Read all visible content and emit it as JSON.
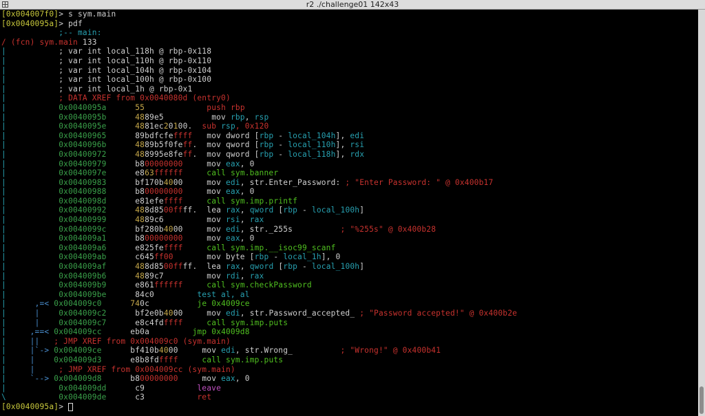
{
  "window": {
    "title": "r2 ./challenge01 142x43"
  },
  "colors": {
    "prompt": "#c9c93c",
    "white": "#d0d0d0",
    "bright": "#ffffff",
    "addr": "#3aa14a",
    "red": "#c8322e",
    "green": "#50c020",
    "cyan": "#27a0b0",
    "yellow": "#c6a84a",
    "blue": "#4a8fd0",
    "magenta": "#c050c0"
  },
  "terminal": {
    "lines": [
      [
        [
          "prompt",
          "[0x004007f0]"
        ],
        [
          "white",
          "> s sym.main"
        ]
      ],
      [
        [
          "prompt",
          "[0x0040095a]"
        ],
        [
          "white",
          "> pdf"
        ]
      ],
      [
        [
          "cyan",
          "            ;-- main:"
        ]
      ],
      [
        [
          "red",
          "/ (fcn) sym.main"
        ],
        [
          "white",
          " 133"
        ]
      ],
      [
        [
          "cyan",
          "|"
        ],
        [
          "white",
          "           ; var int local_118h @ rbp-0x118"
        ]
      ],
      [
        [
          "cyan",
          "|"
        ],
        [
          "white",
          "           ; var int local_110h @ rbp-0x110"
        ]
      ],
      [
        [
          "cyan",
          "|"
        ],
        [
          "white",
          "           ; var int local_104h @ rbp-0x104"
        ]
      ],
      [
        [
          "cyan",
          "|"
        ],
        [
          "white",
          "           ; var int local_100h @ rbp-0x100"
        ]
      ],
      [
        [
          "cyan",
          "|"
        ],
        [
          "white",
          "           ; var int local_1h @ rbp-0x1"
        ]
      ],
      [
        [
          "cyan",
          "|"
        ],
        [
          "red",
          "           ; DATA XREF from 0x0040080d (entry0)"
        ]
      ],
      [
        [
          "cyan",
          "|"
        ],
        [
          "addr",
          "           0x0040095a"
        ],
        [
          "white",
          "      "
        ],
        [
          "yellow",
          "55"
        ],
        [
          "white",
          "             "
        ],
        [
          "red",
          "push rbp"
        ]
      ],
      [
        [
          "cyan",
          "|"
        ],
        [
          "addr",
          "           0x0040095b"
        ],
        [
          "white",
          "      "
        ],
        [
          "yellow",
          "48"
        ],
        [
          "white",
          "89e5          mov "
        ],
        [
          "cyan",
          "rbp"
        ],
        [
          "white",
          ", "
        ],
        [
          "cyan",
          "rsp"
        ]
      ],
      [
        [
          "cyan",
          "|"
        ],
        [
          "addr",
          "           0x0040095e"
        ],
        [
          "white",
          "      "
        ],
        [
          "yellow",
          "48"
        ],
        [
          "white",
          "81ec"
        ],
        [
          "yellow",
          "2"
        ],
        [
          "white",
          "0"
        ],
        [
          "yellow",
          "1"
        ],
        [
          "white",
          "00.  "
        ],
        [
          "red",
          "sub "
        ],
        [
          "cyan",
          "rsp"
        ],
        [
          "red",
          ", 0x120"
        ]
      ],
      [
        [
          "cyan",
          "|"
        ],
        [
          "addr",
          "           0x00400965"
        ],
        [
          "white",
          "      89bdfcfe"
        ],
        [
          "red",
          "ffff"
        ],
        [
          "white",
          "   mov dword ["
        ],
        [
          "cyan",
          "rbp"
        ],
        [
          "white",
          " - "
        ],
        [
          "cyan",
          "local_104h"
        ],
        [
          "white",
          "], "
        ],
        [
          "cyan",
          "edi"
        ]
      ],
      [
        [
          "cyan",
          "|"
        ],
        [
          "addr",
          "           0x0040096b"
        ],
        [
          "white",
          "      "
        ],
        [
          "yellow",
          "48"
        ],
        [
          "white",
          "89b5f0fe"
        ],
        [
          "red",
          "ff"
        ],
        [
          "white",
          ".  mov qword ["
        ],
        [
          "cyan",
          "rbp"
        ],
        [
          "white",
          " - "
        ],
        [
          "cyan",
          "local_110h"
        ],
        [
          "white",
          "], "
        ],
        [
          "cyan",
          "rsi"
        ]
      ],
      [
        [
          "cyan",
          "|"
        ],
        [
          "addr",
          "           0x00400972"
        ],
        [
          "white",
          "      "
        ],
        [
          "yellow",
          "48"
        ],
        [
          "white",
          "8995e8fe"
        ],
        [
          "red",
          "ff"
        ],
        [
          "white",
          ".  mov qword ["
        ],
        [
          "cyan",
          "rbp"
        ],
        [
          "white",
          " - "
        ],
        [
          "cyan",
          "local_118h"
        ],
        [
          "white",
          "], "
        ],
        [
          "cyan",
          "rdx"
        ]
      ],
      [
        [
          "cyan",
          "|"
        ],
        [
          "addr",
          "           0x00400979"
        ],
        [
          "white",
          "      b8"
        ],
        [
          "red",
          "00000000"
        ],
        [
          "white",
          "     mov "
        ],
        [
          "cyan",
          "eax"
        ],
        [
          "white",
          ", 0"
        ]
      ],
      [
        [
          "cyan",
          "|"
        ],
        [
          "addr",
          "           0x0040097e"
        ],
        [
          "white",
          "      e8"
        ],
        [
          "yellow",
          "63"
        ],
        [
          "red",
          "ffffff"
        ],
        [
          "white",
          "     "
        ],
        [
          "green",
          "call sym.banner"
        ]
      ],
      [
        [
          "cyan",
          "|"
        ],
        [
          "addr",
          "           0x00400983"
        ],
        [
          "white",
          "      bf170b"
        ],
        [
          "yellow",
          "40"
        ],
        [
          "white",
          "00     mov "
        ],
        [
          "cyan",
          "edi"
        ],
        [
          "white",
          ", str.Enter_Password: "
        ],
        [
          "red",
          "; \"Enter Password: \" @ 0x400b17"
        ]
      ],
      [
        [
          "cyan",
          "|"
        ],
        [
          "addr",
          "           0x00400988"
        ],
        [
          "white",
          "      b8"
        ],
        [
          "red",
          "00000000"
        ],
        [
          "white",
          "     mov "
        ],
        [
          "cyan",
          "eax"
        ],
        [
          "white",
          ", 0"
        ]
      ],
      [
        [
          "cyan",
          "|"
        ],
        [
          "addr",
          "           0x0040098d"
        ],
        [
          "white",
          "      e81efe"
        ],
        [
          "red",
          "ffff"
        ],
        [
          "white",
          "     "
        ],
        [
          "green",
          "call sym.imp.printf"
        ]
      ],
      [
        [
          "cyan",
          "|"
        ],
        [
          "addr",
          "           0x00400992"
        ],
        [
          "white",
          "      "
        ],
        [
          "yellow",
          "48"
        ],
        [
          "white",
          "8d85"
        ],
        [
          "red",
          "00ff"
        ],
        [
          "white",
          "ff.  lea "
        ],
        [
          "cyan",
          "rax"
        ],
        [
          "white",
          ", "
        ],
        [
          "cyan",
          "qword"
        ],
        [
          "white",
          " ["
        ],
        [
          "cyan",
          "rbp"
        ],
        [
          "white",
          " - "
        ],
        [
          "cyan",
          "local_100h"
        ],
        [
          "white",
          "]"
        ]
      ],
      [
        [
          "cyan",
          "|"
        ],
        [
          "addr",
          "           0x00400999"
        ],
        [
          "white",
          "      "
        ],
        [
          "yellow",
          "48"
        ],
        [
          "white",
          "89c6         mov "
        ],
        [
          "cyan",
          "rsi"
        ],
        [
          "white",
          ", "
        ],
        [
          "cyan",
          "rax"
        ]
      ],
      [
        [
          "cyan",
          "|"
        ],
        [
          "addr",
          "           0x0040099c"
        ],
        [
          "white",
          "      bf280b"
        ],
        [
          "yellow",
          "40"
        ],
        [
          "white",
          "00     mov "
        ],
        [
          "cyan",
          "edi"
        ],
        [
          "white",
          ", str._255s          "
        ],
        [
          "red",
          "; \"%255s\" @ 0x400b28"
        ]
      ],
      [
        [
          "cyan",
          "|"
        ],
        [
          "addr",
          "           0x004009a1"
        ],
        [
          "white",
          "      b8"
        ],
        [
          "red",
          "00000000"
        ],
        [
          "white",
          "     mov "
        ],
        [
          "cyan",
          "eax"
        ],
        [
          "white",
          ", 0"
        ]
      ],
      [
        [
          "cyan",
          "|"
        ],
        [
          "addr",
          "           0x004009a6"
        ],
        [
          "white",
          "      e825fe"
        ],
        [
          "red",
          "ffff"
        ],
        [
          "white",
          "     "
        ],
        [
          "green",
          "call sym.imp.__isoc99_scanf"
        ]
      ],
      [
        [
          "cyan",
          "|"
        ],
        [
          "addr",
          "           0x004009ab"
        ],
        [
          "white",
          "      c645"
        ],
        [
          "red",
          "ff00"
        ],
        [
          "white",
          "       mov byte ["
        ],
        [
          "cyan",
          "rbp"
        ],
        [
          "white",
          " - "
        ],
        [
          "cyan",
          "local_1h"
        ],
        [
          "white",
          "], 0"
        ]
      ],
      [
        [
          "cyan",
          "|"
        ],
        [
          "addr",
          "           0x004009af"
        ],
        [
          "white",
          "      "
        ],
        [
          "yellow",
          "48"
        ],
        [
          "white",
          "8d85"
        ],
        [
          "red",
          "00ff"
        ],
        [
          "white",
          "ff.  lea "
        ],
        [
          "cyan",
          "rax"
        ],
        [
          "white",
          ", "
        ],
        [
          "cyan",
          "qword"
        ],
        [
          "white",
          " ["
        ],
        [
          "cyan",
          "rbp"
        ],
        [
          "white",
          " - "
        ],
        [
          "cyan",
          "local_100h"
        ],
        [
          "white",
          "]"
        ]
      ],
      [
        [
          "cyan",
          "|"
        ],
        [
          "addr",
          "           0x004009b6"
        ],
        [
          "white",
          "      "
        ],
        [
          "yellow",
          "48"
        ],
        [
          "white",
          "89c7         mov "
        ],
        [
          "cyan",
          "rdi"
        ],
        [
          "white",
          ", "
        ],
        [
          "cyan",
          "rax"
        ]
      ],
      [
        [
          "cyan",
          "|"
        ],
        [
          "addr",
          "           0x004009b9"
        ],
        [
          "white",
          "      e861"
        ],
        [
          "red",
          "ffffff"
        ],
        [
          "white",
          "     "
        ],
        [
          "green",
          "call sym.checkPassword"
        ]
      ],
      [
        [
          "cyan",
          "|"
        ],
        [
          "addr",
          "           0x004009be"
        ],
        [
          "white",
          "      84c0         "
        ],
        [
          "cyan",
          "test al, al"
        ]
      ],
      [
        [
          "cyan",
          "|      "
        ],
        [
          "blue",
          ",=<"
        ],
        [
          "addr",
          " 0x004009c0"
        ],
        [
          "white",
          "      "
        ],
        [
          "yellow",
          "74"
        ],
        [
          "white",
          "0c          "
        ],
        [
          "green",
          "je 0x4009ce"
        ]
      ],
      [
        [
          "cyan",
          "|      "
        ],
        [
          "blue",
          "|"
        ],
        [
          "addr",
          "    0x004009c2"
        ],
        [
          "white",
          "      bf2e0b"
        ],
        [
          "yellow",
          "40"
        ],
        [
          "white",
          "00     mov "
        ],
        [
          "cyan",
          "edi"
        ],
        [
          "white",
          ", str.Password_accepted_ "
        ],
        [
          "red",
          "; \"Password accepted!\" @ 0x400b2e"
        ]
      ],
      [
        [
          "cyan",
          "|      "
        ],
        [
          "blue",
          "|"
        ],
        [
          "addr",
          "    0x004009c7"
        ],
        [
          "white",
          "      e8c4fd"
        ],
        [
          "red",
          "ffff"
        ],
        [
          "white",
          "     "
        ],
        [
          "green",
          "call sym.imp.puts"
        ]
      ],
      [
        [
          "cyan",
          "|     "
        ],
        [
          "blue",
          ",==<"
        ],
        [
          "addr",
          " 0x004009cc"
        ],
        [
          "white",
          "      eb0a         "
        ],
        [
          "green",
          "jmp 0x4009d8"
        ]
      ],
      [
        [
          "cyan",
          "|     "
        ],
        [
          "blue",
          "||"
        ],
        [
          "red",
          "   ; JMP XREF from 0x004009c0 (sym.main)"
        ]
      ],
      [
        [
          "cyan",
          "|     "
        ],
        [
          "blue",
          "|`->"
        ],
        [
          "addr",
          " 0x004009ce"
        ],
        [
          "white",
          "      bf410b"
        ],
        [
          "yellow",
          "40"
        ],
        [
          "white",
          "00     mov "
        ],
        [
          "cyan",
          "edi"
        ],
        [
          "white",
          ", str.Wrong_          "
        ],
        [
          "red",
          "; \"Wrong!\" @ 0x400b41"
        ]
      ],
      [
        [
          "cyan",
          "|     "
        ],
        [
          "blue",
          "|"
        ],
        [
          "addr",
          "    0x004009d3"
        ],
        [
          "white",
          "      e8b8fd"
        ],
        [
          "red",
          "ffff"
        ],
        [
          "white",
          "     "
        ],
        [
          "green",
          "call sym.imp.puts"
        ]
      ],
      [
        [
          "cyan",
          "|     "
        ],
        [
          "blue",
          "|"
        ],
        [
          "red",
          "     ; JMP XREF from 0x004009cc (sym.main)"
        ]
      ],
      [
        [
          "cyan",
          "|     "
        ],
        [
          "blue",
          "`-->"
        ],
        [
          "addr",
          " 0x004009d8"
        ],
        [
          "white",
          "      b8"
        ],
        [
          "red",
          "00000000"
        ],
        [
          "white",
          "     mov "
        ],
        [
          "cyan",
          "eax"
        ],
        [
          "white",
          ", 0"
        ]
      ],
      [
        [
          "cyan",
          "|"
        ],
        [
          "addr",
          "           0x004009dd"
        ],
        [
          "white",
          "      c9           "
        ],
        [
          "magenta",
          "leave"
        ]
      ],
      [
        [
          "cyan",
          "\\"
        ],
        [
          "addr",
          "           0x004009de"
        ],
        [
          "white",
          "      c3           "
        ],
        [
          "red",
          "ret"
        ]
      ],
      [
        [
          "prompt",
          "[0x0040095a]"
        ],
        [
          "white",
          "> "
        ]
      ]
    ]
  }
}
